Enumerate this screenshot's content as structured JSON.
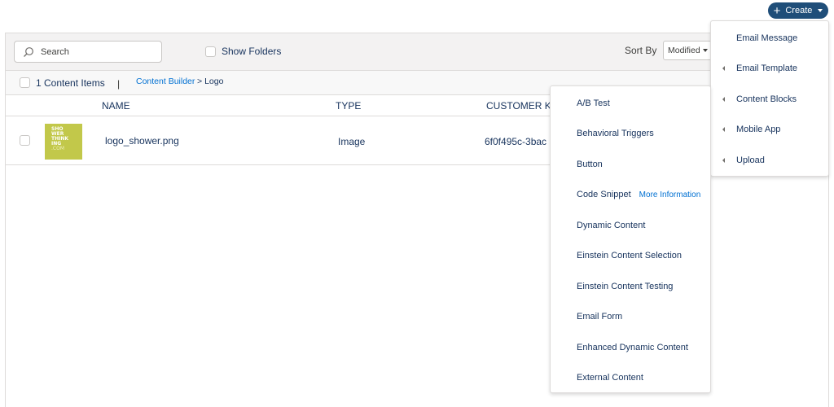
{
  "header": {
    "create_label": "Create"
  },
  "toolbar": {
    "search_placeholder": "Search",
    "show_folders_label": "Show Folders",
    "sort_by_label": "Sort By",
    "sort_value": "Modified"
  },
  "subbar": {
    "count_text": "1 Content Items",
    "separator": "|",
    "breadcrumb_root": "Content Builder",
    "breadcrumb_arrow": ">",
    "breadcrumb_current": "Logo"
  },
  "table": {
    "columns": [
      "NAME",
      "TYPE",
      "CUSTOMER KE"
    ],
    "rows": [
      {
        "thumb_lines": [
          "SHO",
          "WER",
          "THINK",
          "ING",
          ".COM"
        ],
        "name": "logo_shower.png",
        "type": "Image",
        "customer_key": "6f0f495c-3bac"
      }
    ]
  },
  "create_menu": {
    "items": [
      {
        "label": "Email Message",
        "submenu": false
      },
      {
        "label": "Email Template",
        "submenu": true
      },
      {
        "label": "Content Blocks",
        "submenu": true
      },
      {
        "label": "Mobile App",
        "submenu": true
      },
      {
        "label": "Upload",
        "submenu": true
      }
    ]
  },
  "blocks_menu": {
    "items": [
      {
        "label": "A/B Test"
      },
      {
        "label": "Behavioral Triggers"
      },
      {
        "label": "Button"
      },
      {
        "label": "Code Snippet",
        "link": "More Information"
      },
      {
        "label": "Dynamic Content"
      },
      {
        "label": "Einstein Content Selection"
      },
      {
        "label": "Einstein Content Testing"
      },
      {
        "label": "Email Form"
      },
      {
        "label": "Enhanced Dynamic Content"
      },
      {
        "label": "External Content"
      }
    ]
  },
  "colors": {
    "accent": "#1f4e79",
    "link": "#0070d2",
    "thumb": "#c2c84a"
  }
}
